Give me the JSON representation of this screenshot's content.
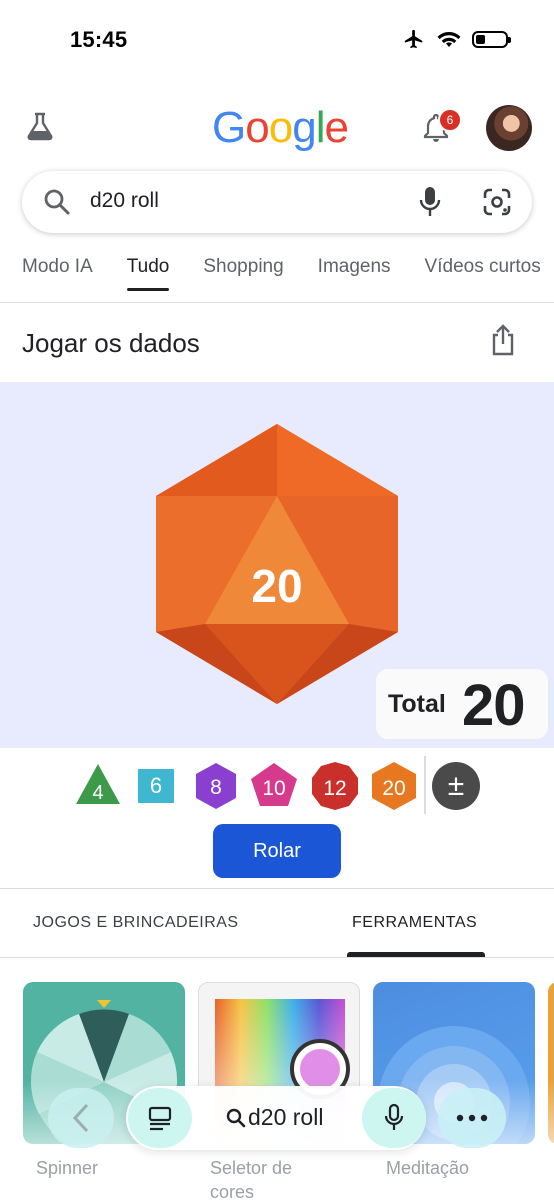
{
  "status": {
    "time": "15:45"
  },
  "header": {
    "logo": [
      "G",
      "o",
      "o",
      "g",
      "l",
      "e"
    ],
    "logo_colors": [
      "#4285F4",
      "#EA4335",
      "#FBBC05",
      "#4285F4",
      "#34A853",
      "#EA4335"
    ],
    "notification_count": "6"
  },
  "search": {
    "query": "d20 roll"
  },
  "tabs": [
    {
      "label": "Modo IA"
    },
    {
      "label": "Tudo"
    },
    {
      "label": "Shopping"
    },
    {
      "label": "Imagens"
    },
    {
      "label": "Vídeos curtos"
    }
  ],
  "card": {
    "title": "Jogar os dados",
    "die_value": "20",
    "total_label": "Total",
    "total_value": "20"
  },
  "dice": [
    {
      "label": "4",
      "color": "#3d9a4a"
    },
    {
      "label": "6",
      "color": "#3fb7d0"
    },
    {
      "label": "8",
      "color": "#8a3fd0"
    },
    {
      "label": "10",
      "color": "#d63a8c"
    },
    {
      "label": "12",
      "color": "#c9302c"
    },
    {
      "label": "20",
      "color": "#e8781f"
    }
  ],
  "modifier_symbol": "±",
  "roll_button": "Rolar",
  "sections": {
    "games": "JOGOS E BRINCADEIRAS",
    "tools": "FERRAMENTAS"
  },
  "tiles": [
    {
      "label": "Spinner"
    },
    {
      "label": "Seletor de cores"
    },
    {
      "label": "Meditação"
    }
  ],
  "bottom_bar": {
    "query": "d20 roll"
  }
}
